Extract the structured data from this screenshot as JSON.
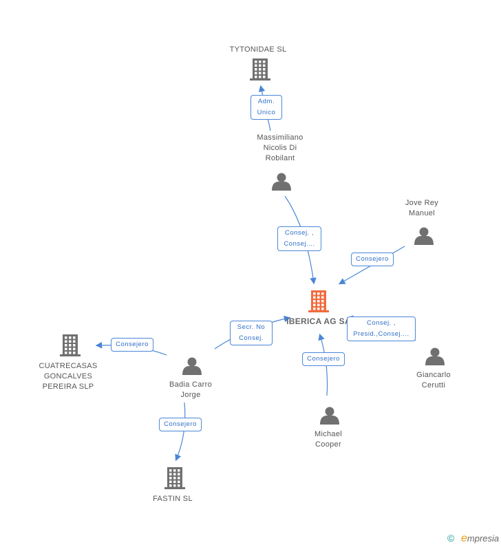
{
  "colors": {
    "company_main": "#f26a3d",
    "company": "#707070",
    "person": "#707070",
    "edge": "#4a86d8"
  },
  "center": {
    "name": "IBERICA AG SA",
    "icon": "building-icon"
  },
  "companies": [
    {
      "name": "TYTONIDAE SL",
      "icon": "building-icon"
    },
    {
      "name": "CUATRECASAS GONCALVES PEREIRA SLP",
      "icon": "building-icon"
    },
    {
      "name": "FASTIN SL",
      "icon": "building-icon"
    }
  ],
  "persons": [
    {
      "name": "Massimiliano Nicolis Di Robilant",
      "icon": "person-icon"
    },
    {
      "name": "Jove Rey Manuel",
      "icon": "person-icon"
    },
    {
      "name": "Badia Carro Jorge",
      "icon": "person-icon"
    },
    {
      "name": "Michael Cooper",
      "icon": "person-icon"
    },
    {
      "name": "Giancarlo Cerutti",
      "icon": "person-icon"
    }
  ],
  "edges": [
    {
      "from": "Massimiliano Nicolis Di Robilant",
      "to": "TYTONIDAE SL",
      "label": "Adm. Unico"
    },
    {
      "from": "Massimiliano Nicolis Di Robilant",
      "to": "IBERICA AG SA",
      "label": "Consej. , Consej...."
    },
    {
      "from": "Jove Rey Manuel",
      "to": "IBERICA AG SA",
      "label": "Consejero"
    },
    {
      "from": "Badia Carro Jorge",
      "to": "IBERICA AG SA",
      "label": "Secr. No Consej."
    },
    {
      "from": "Giancarlo Cerutti",
      "to": "IBERICA AG SA",
      "label": "Consej. , Presid.,Consej...."
    },
    {
      "from": "Michael Cooper",
      "to": "IBERICA AG SA",
      "label": "Consejero"
    },
    {
      "from": "Badia Carro Jorge",
      "to": "CUATRECASAS GONCALVES PEREIRA SLP",
      "label": "Consejero"
    },
    {
      "from": "Badia Carro Jorge",
      "to": "FASTIN SL",
      "label": "Consejero"
    }
  ],
  "footer": {
    "copyright": "©",
    "brand_e": "e",
    "brand_rest": "mpresia"
  }
}
